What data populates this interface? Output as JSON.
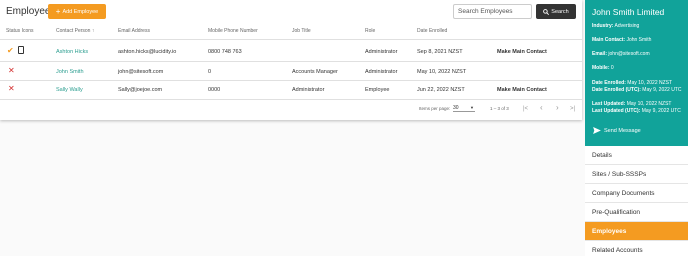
{
  "employees": {
    "title": "Employees",
    "add_label": "Add Employee",
    "search_placeholder": "Search Employees",
    "search_label": "Search",
    "columns": [
      "Status Icons",
      "Contact Person",
      "Email Address",
      "Mobile Phone Number",
      "Job Title",
      "Role",
      "Date Enrolled"
    ],
    "sort_arrow": "↑",
    "rows": [
      {
        "name": "Ashton Hicks",
        "email": "ashton.hicks@lucidity.io",
        "mobile": "0800 748 763",
        "job": "",
        "role": "Administrator",
        "enrolled": "Sep 8, 2021 NZST",
        "action": "Make Main Contact"
      },
      {
        "name": "John Smith",
        "email": "john@sitesoft.com",
        "mobile": "0",
        "job": "Accounts Manager",
        "role": "Administrator",
        "enrolled": "May 10, 2022 NZST",
        "action": ""
      },
      {
        "name": "Sally Wally",
        "email": "Sally@joejoe.com",
        "mobile": "0000",
        "job": "Administrator",
        "role": "Employee",
        "enrolled": "Jun 22, 2022 NZST",
        "action": "Make Main Contact"
      }
    ],
    "pager": {
      "items_label": "Items per page:",
      "per_page": "30",
      "range": "1 – 3 of 3"
    }
  },
  "contact": {
    "name": "John Smith Limited",
    "lines": [
      {
        "label": "Industry:",
        "value": "Advertising"
      },
      {
        "label": "Main Contact:",
        "value": "John Smith"
      },
      {
        "label": "Email:",
        "value": "john@sitesoft.com"
      },
      {
        "label": "Mobile:",
        "value": "0"
      },
      {
        "label": "Date Enrolled:",
        "value": "May 10, 2022 NZST"
      },
      {
        "label": "Date Enrolled (UTC):",
        "value": "May 9, 2022 UTC"
      },
      {
        "label": "Last Updated:",
        "value": "May 10, 2022 NZST"
      },
      {
        "label": "Last Updated (UTC):",
        "value": "May 9, 2022 UTC"
      }
    ],
    "send_label": "Send Message"
  },
  "nav": {
    "items": [
      "Details",
      "Sites / Sub-SSSPs",
      "Company Documents",
      "Pre-Qualification",
      "Employees",
      "Related Accounts"
    ],
    "active_index": 4
  },
  "colors": {
    "accent": "#f49b21",
    "teal": "#11a39a",
    "link": "#2a9d8f",
    "danger": "#d32f2f"
  }
}
